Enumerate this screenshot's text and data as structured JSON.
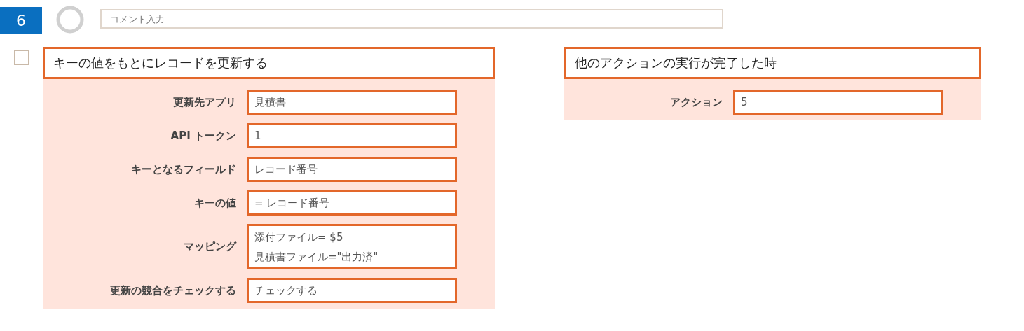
{
  "step": {
    "number": "6",
    "comment": {
      "placeholder": "コメント入力"
    }
  },
  "checkbox": {
    "checked": false
  },
  "panels": [
    {
      "title": "キーの値をもとにレコードを更新する",
      "fields": [
        {
          "kind": "text",
          "label": "更新先アプリ",
          "value": "見積書"
        },
        {
          "kind": "text",
          "label": "API トークン",
          "value": "1"
        },
        {
          "kind": "text",
          "label": "キーとなるフィールド",
          "value": "レコード番号"
        },
        {
          "kind": "text",
          "label": "キーの値",
          "value": "= レコード番号"
        },
        {
          "kind": "multiline",
          "label": "マッピング",
          "lines": [
            "添付ファイル= $5",
            "見積書ファイル=\"出力済\""
          ]
        },
        {
          "kind": "text",
          "label": "更新の競合をチェックする",
          "value": "チェックする"
        }
      ]
    },
    {
      "title": "他のアクションの実行が完了した時",
      "fields": [
        {
          "kind": "text",
          "label": "アクション",
          "value": "5"
        }
      ]
    }
  ]
}
